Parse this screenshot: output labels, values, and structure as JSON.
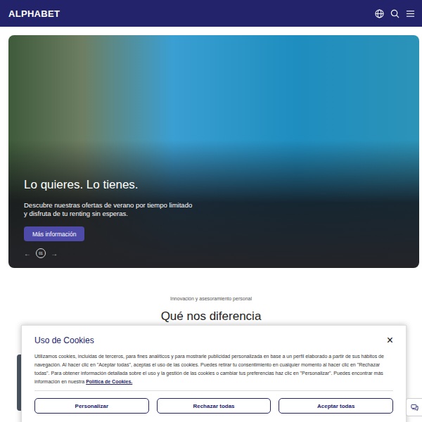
{
  "header": {
    "logo": "ALPHABET"
  },
  "hero": {
    "title": "Lo quieres. Lo tienes.",
    "description": [
      "Descubre nuestras ofertas de verano por tiempo limitado",
      "y disfruta de tu renting sin esperas."
    ],
    "button": "Más información",
    "prev": "←",
    "next": "→",
    "slide": "01"
  },
  "section": {
    "eyebrow": "Innovación y asesoramiento personal",
    "title": "Qué nos diferencia"
  },
  "cookies": {
    "title": "Uso de Cookies",
    "close": "×",
    "text": "Utilizamos cookies, incluidas de terceros, para fines analíticos y para mostrarle publicidad personalizada en base a un perfil elaborado a partir de sus hábitos de navegación. Al hacer clic en \"Aceptar todas\", aceptas el uso de las cookies. Puedes retirar tu consentimiento en cualquier momento al hacer clic en \"Rechazar todas\". Para obtener información detallada sobre el uso y la gestión de las cookies o cambiar tus preferencias haz clic en \"Personalizar\". Puedes encontrar más información en nuestra",
    "link": "Política de Cookies.",
    "buttons": [
      "Personalizar",
      "Rechazar todas",
      "Aceptar todas"
    ]
  }
}
